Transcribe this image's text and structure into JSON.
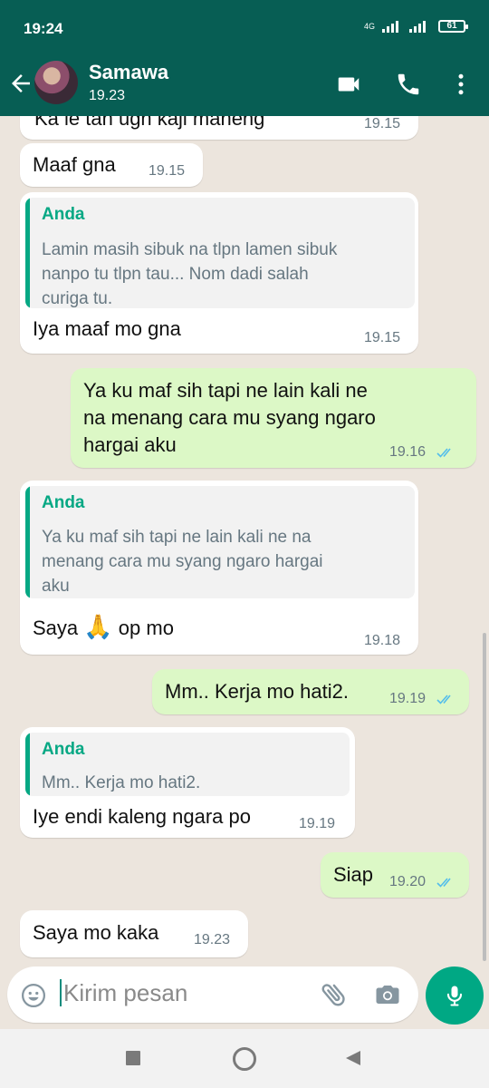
{
  "status_bar": {
    "time": "19:24",
    "network": "4G",
    "battery": "61"
  },
  "header": {
    "contact_name": "Samawa",
    "last_seen": "19.23"
  },
  "messages": [
    {
      "direction": "in",
      "text": "Ka le tah ugh kaji maneng",
      "time": "19.15"
    },
    {
      "direction": "in",
      "text": "Maaf gna",
      "time": "19.15"
    },
    {
      "direction": "in",
      "quote_author": "Anda",
      "quote_lines": [
        "Lamin masih sibuk na tlpn lamen sibuk",
        "nanpo tu tlpn tau... Nom dadi salah",
        "curiga tu."
      ],
      "text": "Iya maaf mo gna",
      "time": "19.15"
    },
    {
      "direction": "out",
      "text_lines": [
        "Ya ku maf sih tapi ne lain kali ne",
        "na menang cara mu syang ngaro",
        "hargai aku"
      ],
      "time": "19.16",
      "status": "read"
    },
    {
      "direction": "in",
      "quote_author": "Anda",
      "quote_lines": [
        "Ya ku maf sih tapi ne lain kali ne na",
        "menang cara mu syang ngaro hargai",
        "aku"
      ],
      "text_before": "Saya",
      "emoji": "🙏",
      "text_after": "op mo",
      "time": "19.18"
    },
    {
      "direction": "out",
      "text": "Mm.. Kerja mo hati2.",
      "time": "19.19",
      "status": "read"
    },
    {
      "direction": "in",
      "quote_author": "Anda",
      "quote_lines": [
        "Mm.. Kerja mo hati2."
      ],
      "text": "Iye endi kaleng ngara po",
      "time": "19.19"
    },
    {
      "direction": "out",
      "text": "Siap",
      "time": "19.20",
      "status": "read"
    },
    {
      "direction": "in",
      "text": "Saya mo kaka",
      "time": "19.23"
    }
  ],
  "composer": {
    "placeholder": "Kirim pesan"
  },
  "icons": {
    "back": "arrow-left-icon",
    "video": "video-call-icon",
    "call": "phone-icon",
    "menu": "more-vert-icon",
    "emoji": "emoji-icon",
    "attach": "paperclip-icon",
    "camera": "camera-icon",
    "mic": "microphone-icon",
    "nav_recents": "square-icon",
    "nav_home": "circle-icon",
    "nav_back": "triangle-back-icon"
  },
  "colors": {
    "header": "#075e54",
    "incoming": "#ffffff",
    "outgoing": "#dcf8c6",
    "accent": "#00a884",
    "quote_author": "#06a884",
    "read_ticks": "#53bdeb"
  }
}
